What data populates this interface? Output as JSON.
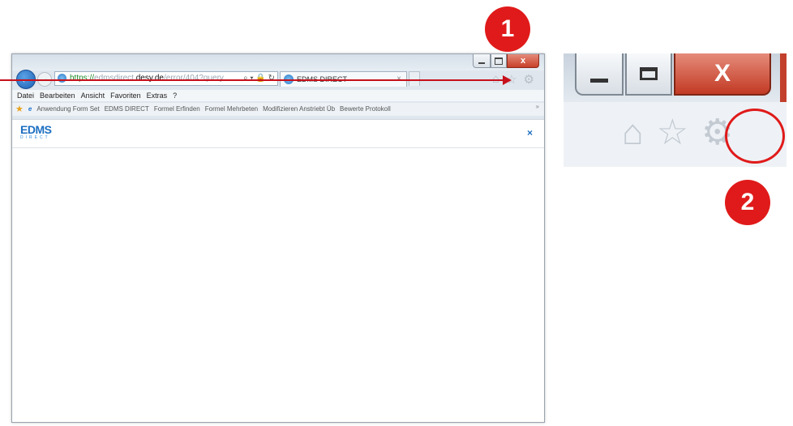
{
  "browser": {
    "address": {
      "https": "https://",
      "host_prefix": "edmsdirect.",
      "host": "desy.de",
      "path": "/error/404?query",
      "tools": "⌕ ▾ 🔒 ↻"
    },
    "tab": {
      "title": "EDMS DIRECT",
      "close": "×"
    },
    "caption": {
      "close": "x"
    },
    "nav_icons": {
      "home": "⌂",
      "star": "☆",
      "gear": "⚙"
    },
    "menu": [
      "Datei",
      "Bearbeiten",
      "Ansicht",
      "Favoriten",
      "Extras",
      "?"
    ],
    "favorites": [
      "Anwendung Form Set",
      "EDMS DIRECT",
      "Formel Erfinden",
      "Formel Mehrbeten",
      "Modifizieren Anstriebt Üb",
      "Bewerte Protokoll"
    ],
    "page": {
      "logo": "EDMS",
      "logo_sub": "DIRECT",
      "close": "×"
    }
  },
  "annotations": {
    "badge_1": "1",
    "badge_2": "2",
    "color": "#e01a1a"
  },
  "zoom": {
    "close": "X",
    "home": "⌂",
    "star": "☆",
    "gear": "⚙"
  }
}
